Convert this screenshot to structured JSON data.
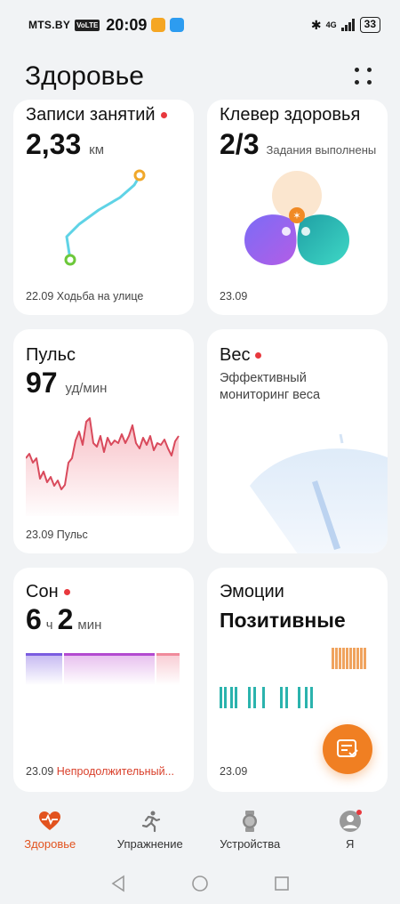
{
  "status_bar": {
    "carrier": "MTS.BY",
    "volte": "VoLTE",
    "time": "20:09",
    "network": "4G",
    "battery": "33"
  },
  "header": {
    "title": "Здоровье"
  },
  "cards": {
    "workouts": {
      "title": "Записи занятий",
      "value": "2,33",
      "unit": "км",
      "date": "22.09",
      "label": "Ходьба на улице"
    },
    "clover": {
      "title": "Клевер здоровья",
      "value": "2/3",
      "subtitle": "Задания выполнены",
      "date": "23.09"
    },
    "pulse": {
      "title": "Пульс",
      "value": "97",
      "unit": "уд/мин",
      "date": "23.09",
      "label": "Пульс"
    },
    "weight": {
      "title": "Вес",
      "description": "Эффективный мониторинг веса"
    },
    "sleep": {
      "title": "Сон",
      "hours": "6",
      "hours_unit": "ч",
      "minutes": "2",
      "minutes_unit": "мин",
      "date": "23.09",
      "label": "Непродолжительный..."
    },
    "emotions": {
      "title": "Эмоции",
      "value": "Позитивные",
      "date": "23.09"
    }
  },
  "bottom_nav": [
    {
      "label": "Здоровье",
      "icon": "heart-pulse-icon",
      "active": true
    },
    {
      "label": "Упражнение",
      "icon": "running-icon",
      "active": false
    },
    {
      "label": "Устройства",
      "icon": "watch-icon",
      "active": false
    },
    {
      "label": "Я",
      "icon": "profile-icon",
      "active": false
    }
  ],
  "colors": {
    "accent": "#e2531f",
    "pulse_line": "#d94a5c",
    "route": "#5fd3e6",
    "emotion_orange": "#f0a35e",
    "emotion_teal": "#2bb3ad",
    "sleep_purple": "#a86be0"
  }
}
